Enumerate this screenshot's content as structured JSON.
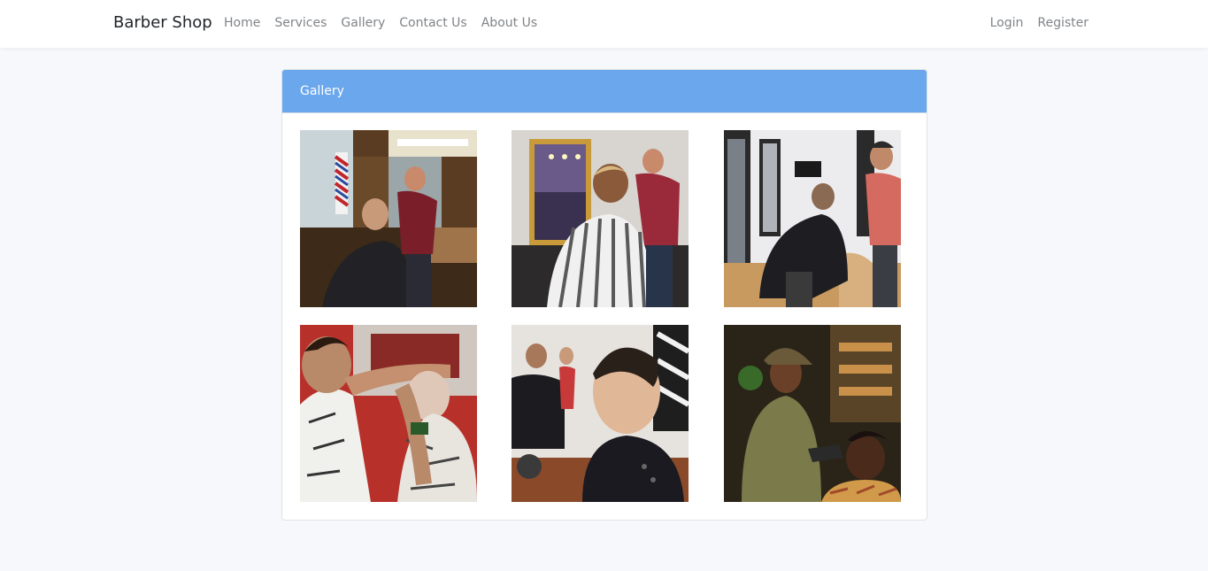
{
  "navbar": {
    "brand": "Barber Shop",
    "links": [
      "Home",
      "Services",
      "Gallery",
      "Contact Us",
      "About Us"
    ],
    "auth": [
      "Login",
      "Register"
    ]
  },
  "gallery": {
    "title": "Gallery",
    "photos": [
      {
        "name": "barber-photo-1"
      },
      {
        "name": "barber-photo-2"
      },
      {
        "name": "barber-photo-3"
      },
      {
        "name": "barber-photo-4"
      },
      {
        "name": "barber-photo-5"
      },
      {
        "name": "barber-photo-6"
      }
    ]
  },
  "colors": {
    "header": "#6aa7ec",
    "background": "#f7f8fb"
  }
}
